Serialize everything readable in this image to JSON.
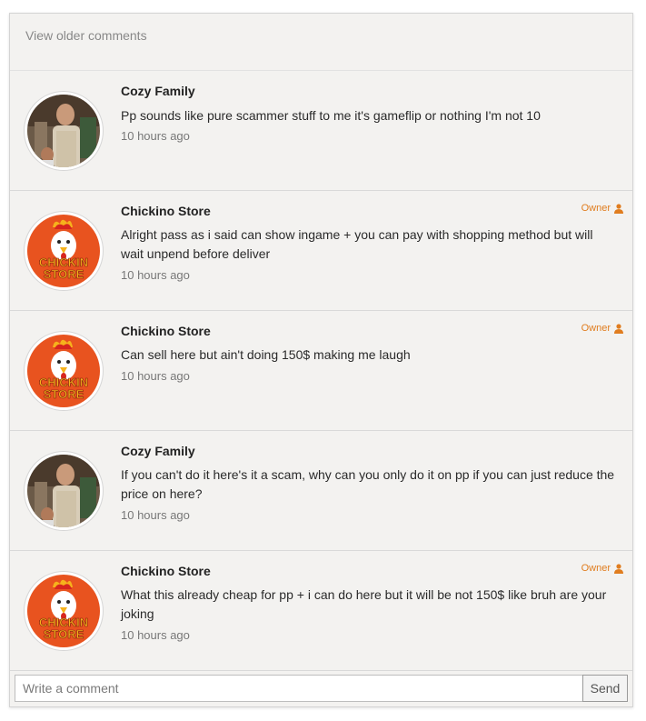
{
  "header": {
    "view_older": "View older comments"
  },
  "comments": [
    {
      "author": "Cozy Family",
      "text": "Pp sounds like pure scammer stuff to me it's gameflip or nothing I'm not 10",
      "time": "10 hours ago",
      "badge": "",
      "avatar": "person-photo"
    },
    {
      "author": "Chickino Store",
      "text": "Alright pass as i said can show ingame + you can pay with shopping method but will wait unpend before deliver",
      "time": "10 hours ago",
      "badge": "Owner",
      "avatar": "chickin-store-logo"
    },
    {
      "author": "Chickino Store",
      "text": "Can sell here but ain't doing 150$ making me laugh",
      "time": "10 hours ago",
      "badge": "Owner",
      "avatar": "chickin-store-logo"
    },
    {
      "author": "Cozy Family",
      "text": "If you can't do it here's it a scam, why can you only do it on pp if you can just reduce the price on here?",
      "time": "10 hours ago",
      "badge": "",
      "avatar": "person-photo"
    },
    {
      "author": "Chickino Store",
      "text": "What this already cheap for pp + i can do here but it will be not 150$ like bruh are your joking",
      "time": "10 hours ago",
      "badge": "Owner",
      "avatar": "chickin-store-logo"
    }
  ],
  "logo_text": {
    "line1": "CHICKIN",
    "line2": "STORE"
  },
  "composer": {
    "placeholder": "Write a comment",
    "send_label": "Send"
  },
  "colors": {
    "owner_accent": "#e07d1f",
    "logo_orange": "#e8531f",
    "panel_bg": "#f3f2f0"
  }
}
